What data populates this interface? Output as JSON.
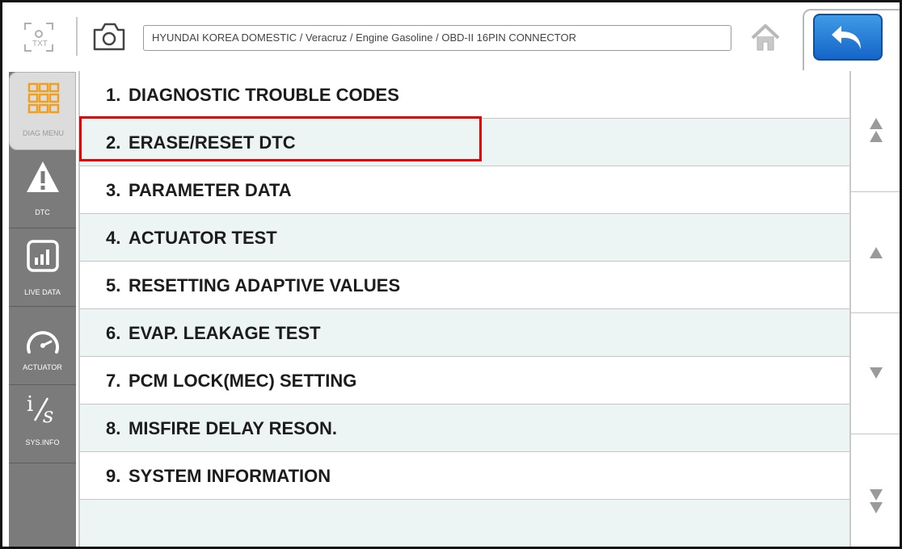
{
  "header": {
    "breadcrumb": "HYUNDAI KOREA DOMESTIC / Veracruz / Engine Gasoline / OBD-II 16PIN CONNECTOR",
    "txt_icon_label": "TXT",
    "back_button_color": "#1f78d6"
  },
  "sidebar": {
    "items": [
      {
        "label": "DIAG MENU",
        "icon": "grid-icon",
        "active": true
      },
      {
        "label": "DTC",
        "icon": "warning-icon",
        "active": false
      },
      {
        "label": "LIVE DATA",
        "icon": "bar-chart-icon",
        "active": false
      },
      {
        "label": "ACTUATOR",
        "icon": "gauge-icon",
        "active": false
      },
      {
        "label": "SYS.INFO",
        "icon": "info-icon",
        "active": false
      }
    ]
  },
  "menu": {
    "items": [
      {
        "num": "1.",
        "label": "DIAGNOSTIC TROUBLE CODES"
      },
      {
        "num": "2.",
        "label": "ERASE/RESET DTC"
      },
      {
        "num": "3.",
        "label": "PARAMETER DATA"
      },
      {
        "num": "4.",
        "label": "ACTUATOR TEST"
      },
      {
        "num": "5.",
        "label": "RESETTING ADAPTIVE VALUES"
      },
      {
        "num": "6.",
        "label": "EVAP. LEAKAGE TEST"
      },
      {
        "num": "7.",
        "label": "PCM LOCK(MEC) SETTING"
      },
      {
        "num": "8.",
        "label": "MISFIRE DELAY RESON."
      },
      {
        "num": "9.",
        "label": "SYSTEM INFORMATION"
      }
    ],
    "highlighted_item": "ERASE/RESET DTC",
    "highlight_color": "#e50000"
  },
  "scroll": {
    "buttons": [
      "page-up-icon",
      "up-icon",
      "down-icon",
      "page-down-icon"
    ]
  }
}
